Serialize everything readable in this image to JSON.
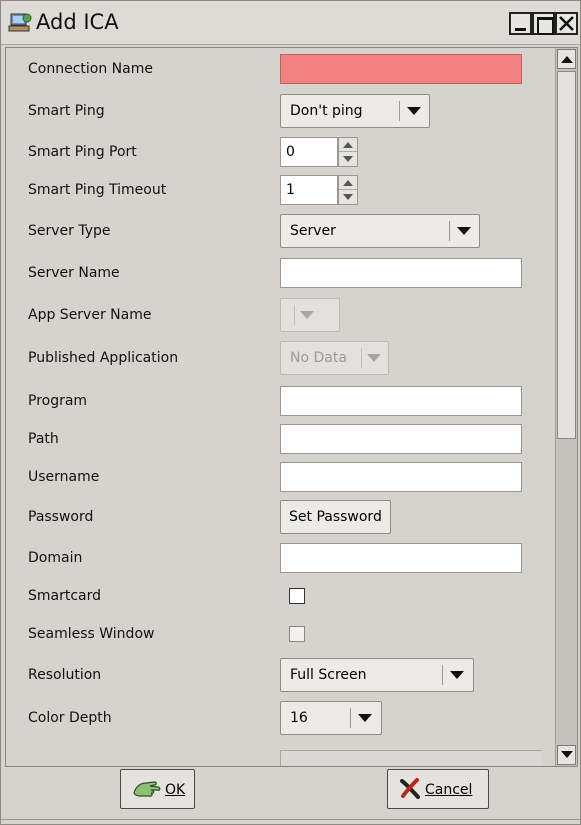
{
  "window": {
    "title": "Add ICA",
    "icon": "network-computer-icon"
  },
  "form": {
    "connection_name": {
      "label": "Connection Name",
      "value": ""
    },
    "smart_ping": {
      "label": "Smart Ping",
      "value": "Don't ping"
    },
    "smart_ping_port": {
      "label": "Smart Ping Port",
      "value": "0"
    },
    "smart_ping_timeout": {
      "label": "Smart Ping Timeout",
      "value": "1"
    },
    "server_type": {
      "label": "Server Type",
      "value": "Server"
    },
    "server_name": {
      "label": "Server Name",
      "value": ""
    },
    "app_server_name": {
      "label": "App Server Name",
      "value": ""
    },
    "published_application": {
      "label": "Published Application",
      "value": "No Data"
    },
    "program": {
      "label": "Program",
      "value": ""
    },
    "path": {
      "label": "Path",
      "value": ""
    },
    "username": {
      "label": "Username",
      "value": ""
    },
    "password": {
      "label": "Password",
      "button": "Set Password"
    },
    "domain": {
      "label": "Domain",
      "value": ""
    },
    "smartcard": {
      "label": "Smartcard",
      "checked": false
    },
    "seamless_window": {
      "label": "Seamless Window",
      "checked": false
    },
    "resolution": {
      "label": "Resolution",
      "value": "Full Screen"
    },
    "color_depth": {
      "label": "Color Depth",
      "value": "16"
    }
  },
  "buttons": {
    "ok": "OK",
    "cancel": "Cancel"
  },
  "colors": {
    "error_field": "#f38181",
    "dialog_bg": "#d6d3cf"
  }
}
